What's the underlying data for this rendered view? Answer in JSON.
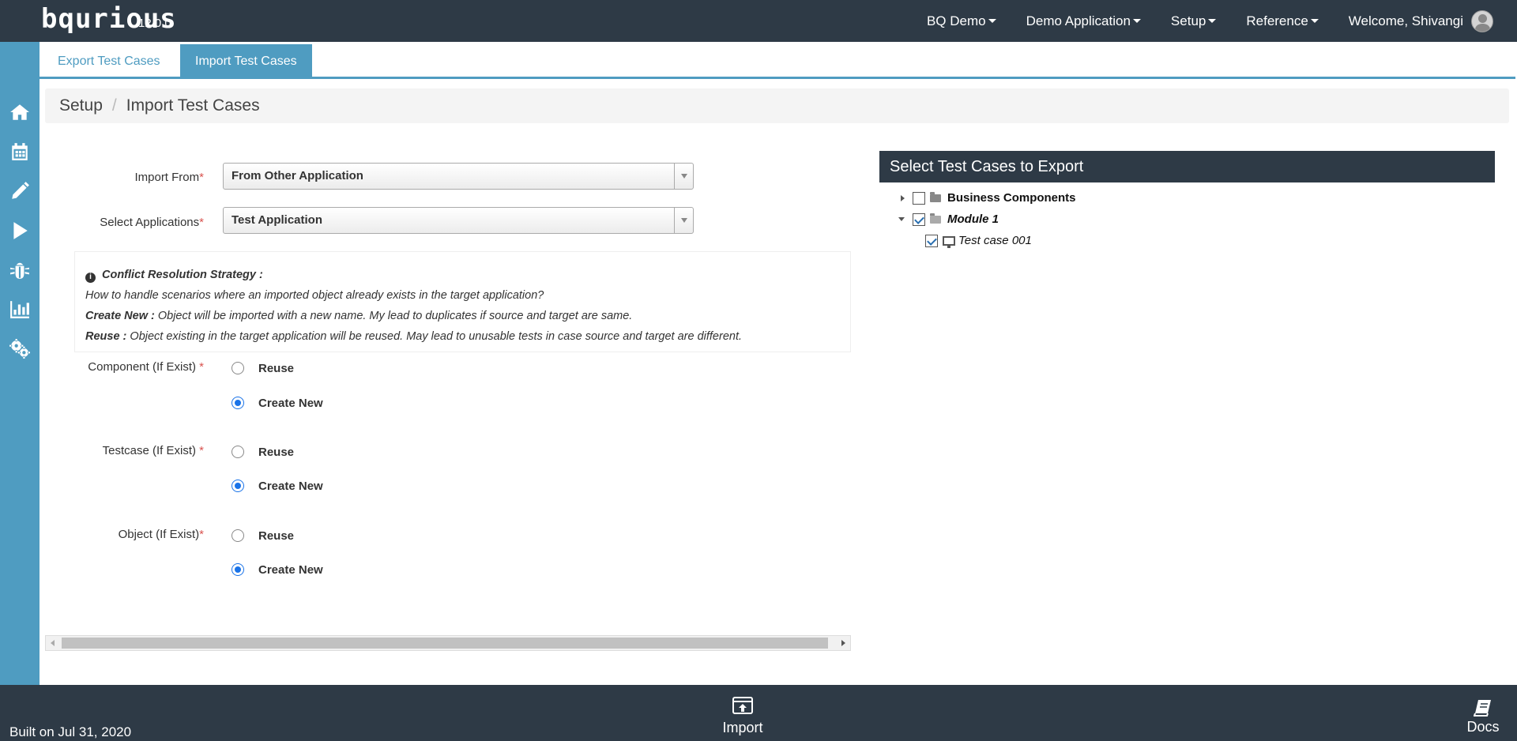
{
  "topbar": {
    "logo": "bqurious",
    "version": "12.0.0",
    "nav": [
      "BQ Demo",
      "Demo Application",
      "Setup",
      "Reference"
    ],
    "welcome": "Welcome, Shivangi"
  },
  "sidebar": {
    "icons": [
      "home-icon",
      "calendar-icon",
      "pencil-icon",
      "play-icon",
      "bug-icon",
      "bar-chart-icon",
      "gears-icon"
    ]
  },
  "tabs": {
    "export": "Export Test Cases",
    "import": "Import Test Cases"
  },
  "breadcrumb": {
    "root": "Setup",
    "current": "Import Test Cases"
  },
  "form": {
    "import_from_label": "Import From",
    "import_from_value": "From Other Application",
    "select_apps_label": "Select Applications",
    "select_apps_value": "Test Application",
    "info": {
      "title": "Conflict Resolution Strategy :",
      "question": "How to handle scenarios where an imported object already exists in the target application?",
      "create_new_label": "Create New :",
      "create_new_desc": " Object will be imported with a new name. My lead to duplicates if source and target are same.",
      "reuse_label": "Reuse :",
      "reuse_desc": " Object existing in the target application will be reused. May lead to unusable tests in case source and target are different."
    },
    "component_label": "Component (If Exist) ",
    "testcase_label": "Testcase (If Exist) ",
    "object_label": "Object (If Exist)",
    "reuse": "Reuse",
    "create_new": "Create New",
    "required_mark": "*"
  },
  "tree": {
    "title": "Select Test Cases to Export",
    "business_components": "Business Components",
    "module": "Module 1",
    "testcase": "Test case 001"
  },
  "footer": {
    "built": "Built on Jul 31, 2020",
    "import": "Import",
    "docs": "Docs"
  }
}
